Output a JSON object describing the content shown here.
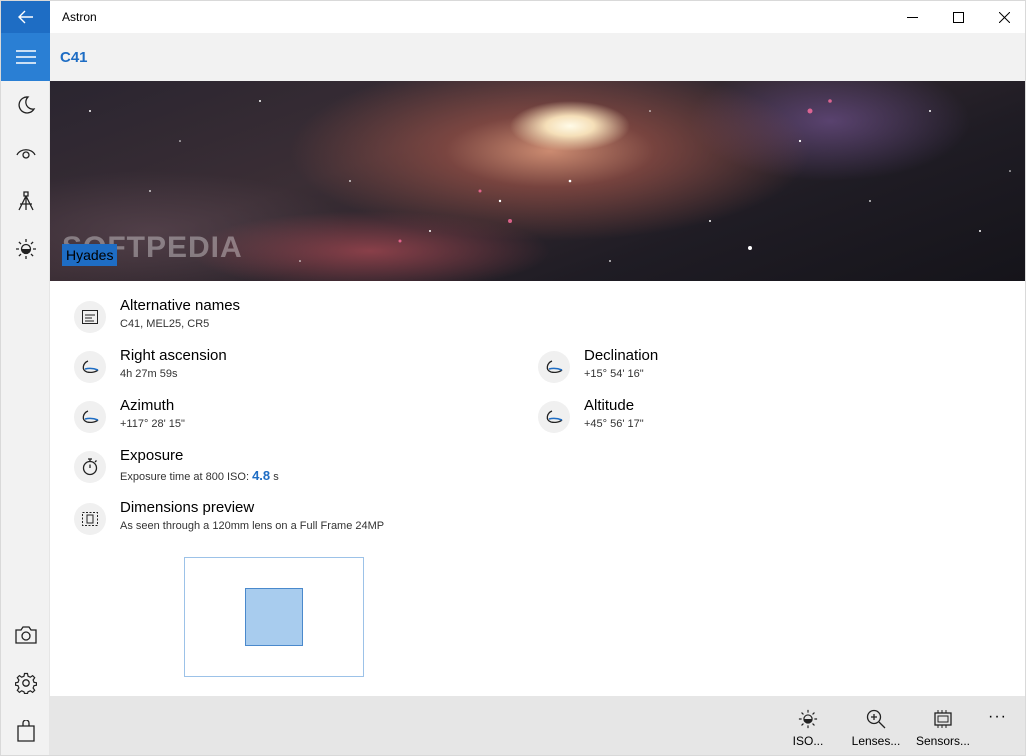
{
  "window": {
    "app_title": "Astron",
    "minimize_label": "—",
    "maximize_label": "☐",
    "close_label": "✕"
  },
  "header": {
    "title": "C41"
  },
  "hero": {
    "label": "Hyades",
    "watermark": "SOFTPEDIA"
  },
  "sidebar": {
    "items": [
      {
        "icon": "hamburger-menu-icon"
      },
      {
        "icon": "moon-icon"
      },
      {
        "icon": "eye-icon"
      },
      {
        "icon": "telescope-icon"
      },
      {
        "icon": "brightness-icon"
      },
      {
        "icon": "camera-icon"
      },
      {
        "icon": "gear-icon"
      },
      {
        "icon": "shopping-bag-icon"
      }
    ]
  },
  "details": {
    "alternative_names": {
      "title": "Alternative names",
      "value": "C41, MEL25, CR5"
    },
    "right_ascension": {
      "title": "Right ascension",
      "value": "4h 27m 59s"
    },
    "declination": {
      "title": "Declination",
      "value": "+15° 54' 16\""
    },
    "azimuth": {
      "title": "Azimuth",
      "value": "+117° 28' 15\""
    },
    "altitude": {
      "title": "Altitude",
      "value": "+45° 56' 17\""
    },
    "exposure": {
      "title": "Exposure",
      "prefix": "Exposure time at 800 ISO: ",
      "value": "4.8",
      "unit": " s"
    },
    "dimensions_preview": {
      "title": "Dimensions preview",
      "value": "As seen through a 120mm lens on a Full Frame 24MP"
    }
  },
  "command_bar": {
    "iso_label": "ISO...",
    "lenses_label": "Lenses...",
    "sensors_label": "Sensors...",
    "more_label": "···"
  },
  "colors": {
    "accent": "#1e6dc4",
    "sidebar_selected": "#2a7fd4",
    "preview_fill": "#a8ccee"
  }
}
